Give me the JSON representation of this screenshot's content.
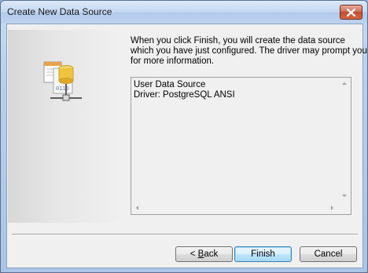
{
  "window": {
    "title": "Create New Data Source"
  },
  "description": {
    "lines": [
      "When you click Finish, you will create the data source",
      "which you have just configured.  The driver may prompt you",
      "for more information."
    ]
  },
  "summary": {
    "lines": [
      "User Data Source",
      "Driver:  PostgreSQL ANSI"
    ]
  },
  "buttons": {
    "back": {
      "mnemonic": "B",
      "rest": "ack",
      "prefix": "< "
    },
    "finish": "Finish",
    "cancel": "Cancel"
  },
  "icons": {
    "close": "close-icon",
    "wizard": "data-source-icon"
  },
  "colors": {
    "close_button": "#c14a2f",
    "default_button_border": "#3c7fb1"
  }
}
